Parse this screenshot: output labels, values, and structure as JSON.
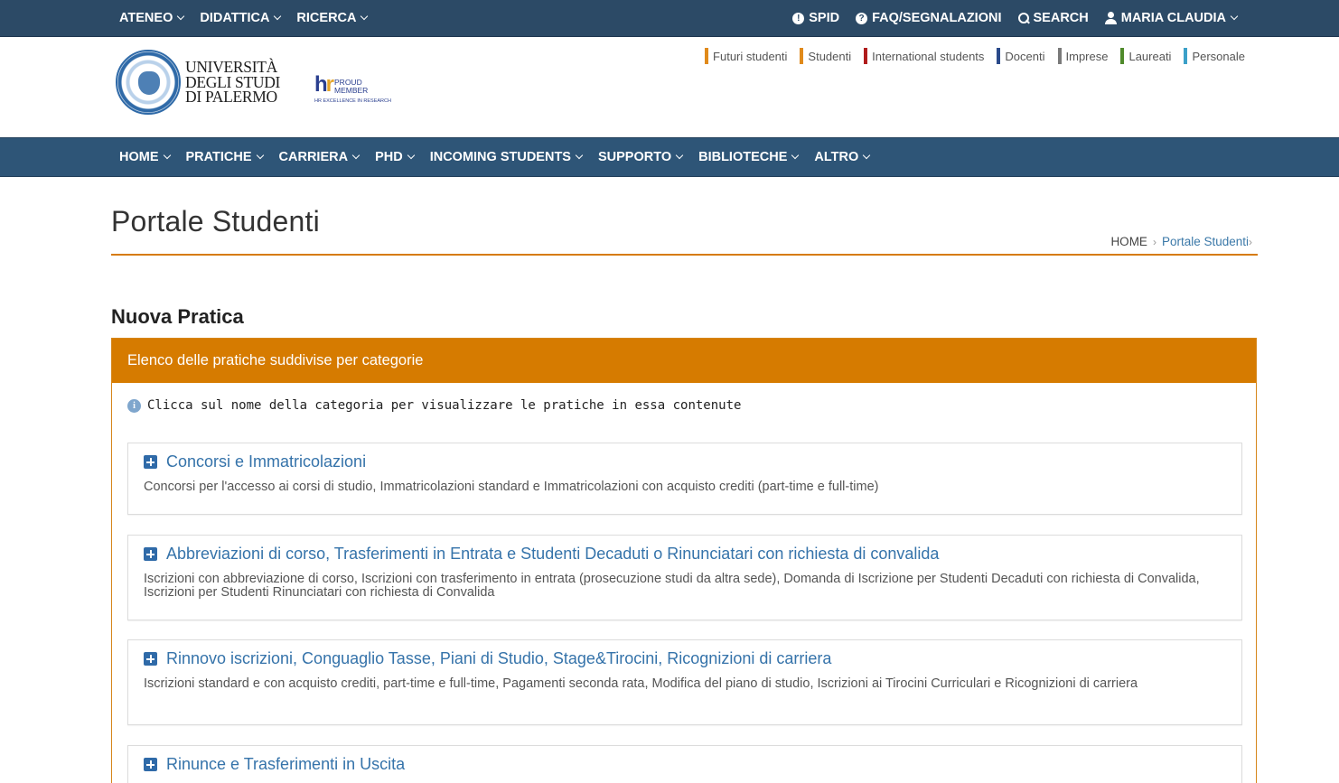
{
  "topbar": {
    "left": [
      "ATENEO",
      "DIDATTICA",
      "RICERCA"
    ],
    "spid": "SPID",
    "faq": "FAQ/SEGNALAZIONI",
    "search": "SEARCH",
    "user": "MARIA CLAUDIA"
  },
  "header": {
    "logo_line1": "UNIVERSITÀ",
    "logo_line2": "DEGLI STUDI",
    "logo_line3": "DI PALERMO",
    "hr_line1": "PROUD",
    "hr_line2": "MEMBER",
    "hr_sub": "HR EXCELLENCE IN RESEARCH",
    "audience": [
      {
        "label": "Futuri studenti",
        "color": "#e08a1b"
      },
      {
        "label": "Studenti",
        "color": "#e08a1b"
      },
      {
        "label": "International students",
        "color": "#b01c1c"
      },
      {
        "label": "Docenti",
        "color": "#2a4a8a"
      },
      {
        "label": "Imprese",
        "color": "#7a7a7a"
      },
      {
        "label": "Laureati",
        "color": "#4f8a2b"
      },
      {
        "label": "Personale",
        "color": "#3ba0c8"
      }
    ]
  },
  "mainnav": [
    "HOME",
    "PRATICHE",
    "CARRIERA",
    "PHD",
    "INCOMING STUDENTS",
    "SUPPORTO",
    "BIBLIOTECHE",
    "ALTRO"
  ],
  "page": {
    "title": "Portale Studenti",
    "breadcrumb_home": "HOME",
    "breadcrumb_current": "Portale Studenti",
    "section_title": "Nuova Pratica"
  },
  "panel": {
    "header": "Elenco delle pratiche suddivise per categorie",
    "info": "Clicca sul nome della categoria per visualizzare le pratiche in essa contenute",
    "categories": [
      {
        "title": "Concorsi e Immatricolazioni",
        "desc": "Concorsi per l'accesso ai corsi di studio, Immatricolazioni standard e Immatricolazioni con acquisto crediti (part-time e full-time)"
      },
      {
        "title": "Abbreviazioni di corso, Trasferimenti in Entrata e Studenti Decaduti o Rinunciatari con richiesta di convalida",
        "desc": "Iscrizioni con abbreviazione di corso, Iscrizioni con trasferimento in entrata (prosecuzione studi da altra sede), Domanda di Iscrizione per Studenti Decaduti con richiesta di Convalida, Iscrizioni per Studenti Rinunciatari con richiesta di Convalida"
      },
      {
        "title": "Rinnovo iscrizioni, Conguaglio Tasse, Piani di Studio, Stage&Tirocini, Ricognizioni di carriera",
        "desc": "Iscrizioni standard e con acquisto crediti, part-time e full-time, Pagamenti seconda rata, Modifica del piano di studio, Iscrizioni ai Tirocini Curriculari e Ricognizioni di carriera"
      },
      {
        "title": "Rinunce e Trasferimenti in Uscita",
        "desc": ""
      }
    ]
  }
}
